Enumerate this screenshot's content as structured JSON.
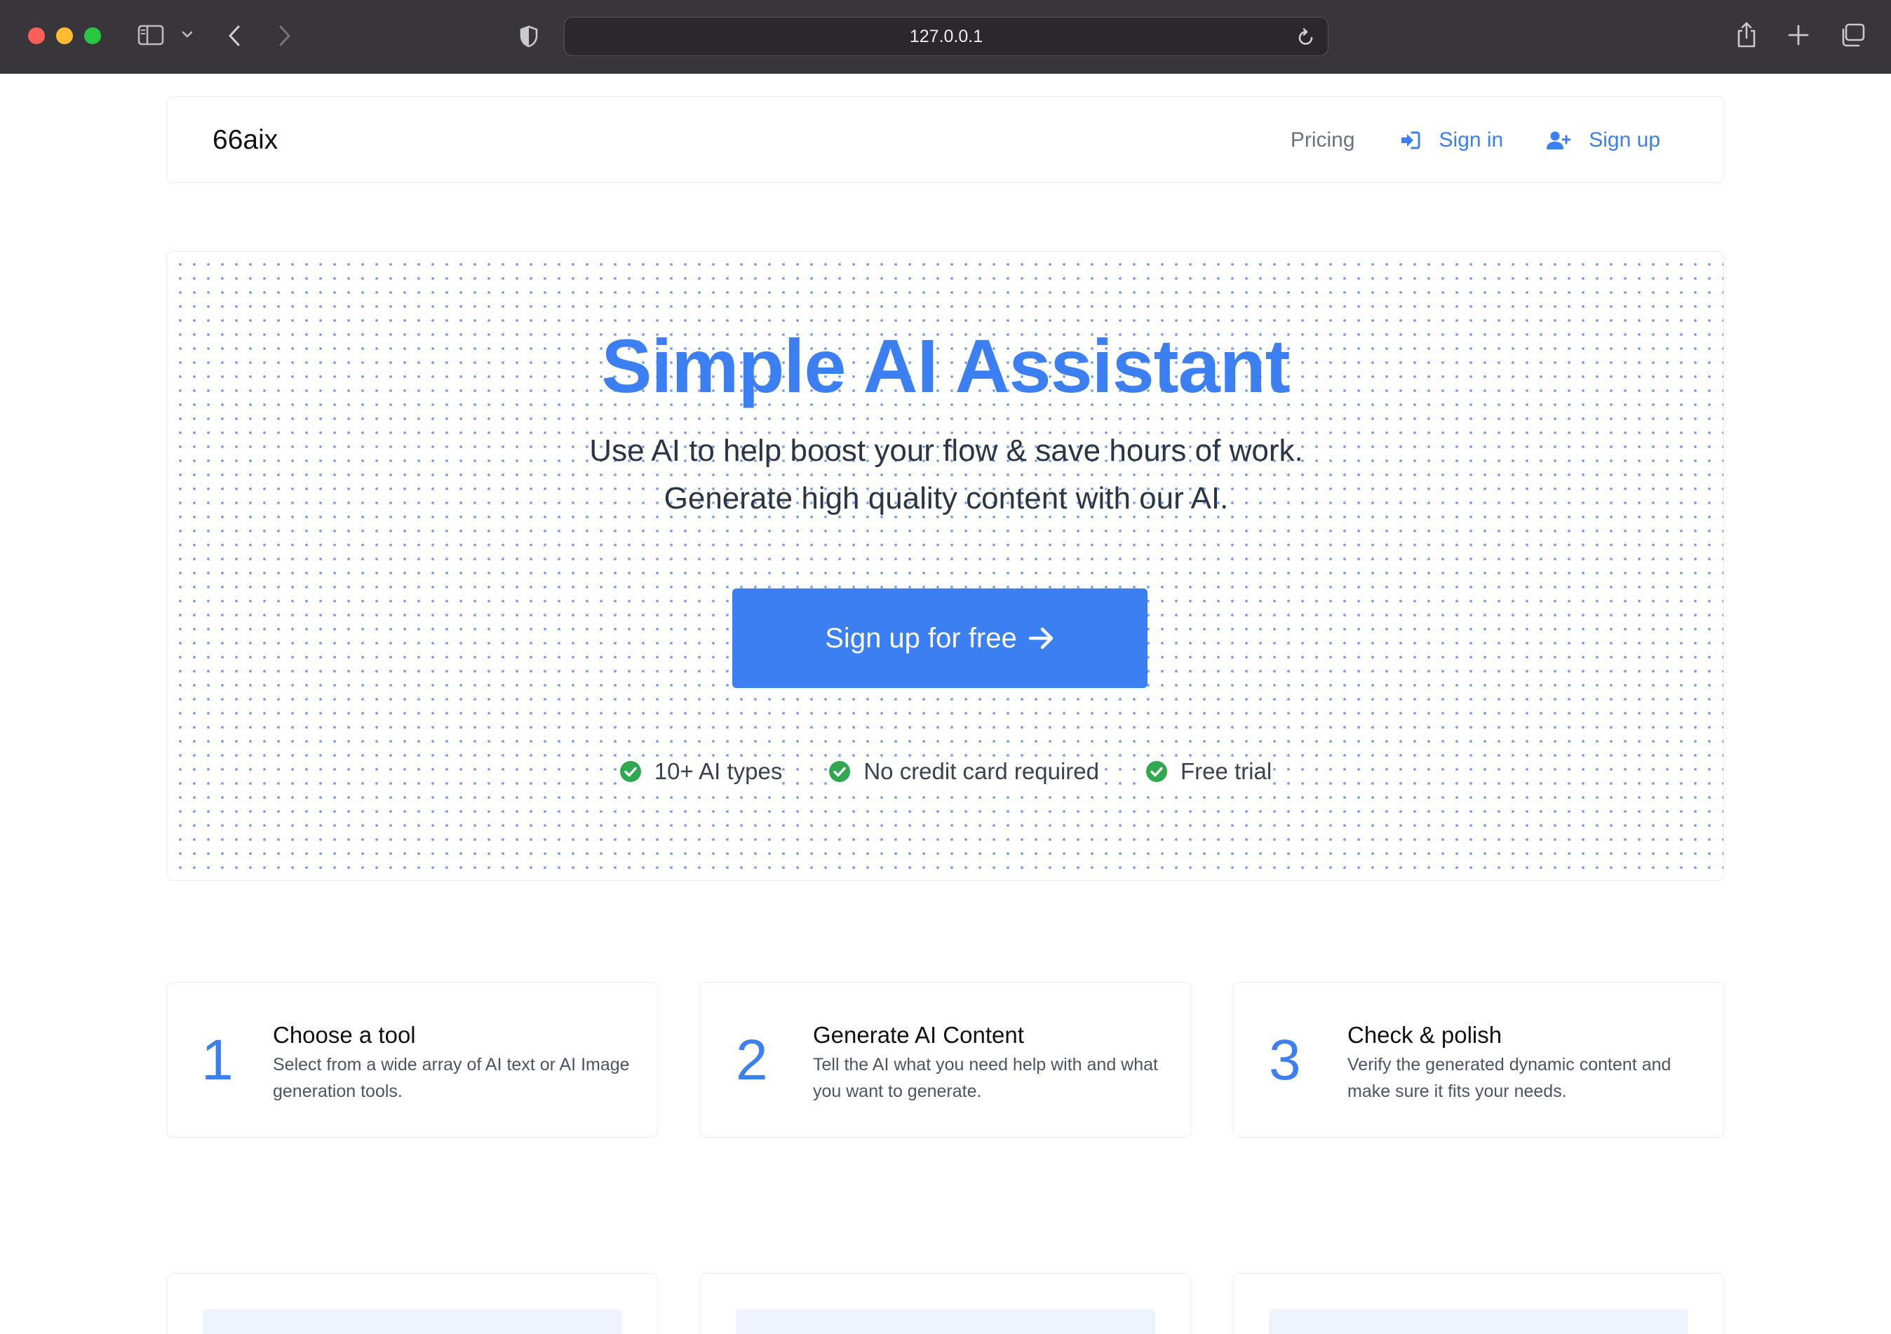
{
  "browser": {
    "url": "127.0.0.1"
  },
  "navbar": {
    "logo": "66aix",
    "links": {
      "pricing": "Pricing",
      "sign_in": "Sign in",
      "sign_up": "Sign up"
    }
  },
  "hero": {
    "title": "Simple AI Assistant",
    "subtitle": "Use AI to help boost your flow & save hours of work. Generate high quality content with our AI.",
    "cta_label": "Sign up for free",
    "perks": [
      "10+ AI types",
      "No credit card required",
      "Free trial"
    ]
  },
  "steps": [
    {
      "number": "1",
      "title": "Choose a tool",
      "description": "Select from a wide array of AI text or AI Image generation tools."
    },
    {
      "number": "2",
      "title": "Generate AI Content",
      "description": "Tell the AI what you need help with and what you want to generate."
    },
    {
      "number": "3",
      "title": "Check & polish",
      "description": "Verify the generated dynamic content and make sure it fits your needs."
    }
  ],
  "colors": {
    "accent": "#3b7ff2",
    "success": "#2fa84f",
    "chrome": "#38353b"
  },
  "icons": {
    "sign_in": "sign-in-icon",
    "sign_up": "user-plus-icon",
    "cta": "arrow-right-icon",
    "perk": "check-circle-icon"
  }
}
